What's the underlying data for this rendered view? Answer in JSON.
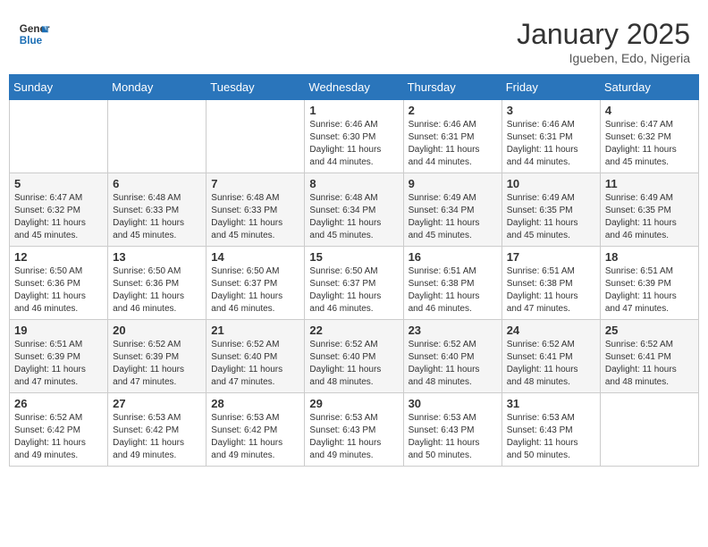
{
  "header": {
    "logo_general": "General",
    "logo_blue": "Blue",
    "month_title": "January 2025",
    "location": "Igueben, Edo, Nigeria"
  },
  "days_of_week": [
    "Sunday",
    "Monday",
    "Tuesday",
    "Wednesday",
    "Thursday",
    "Friday",
    "Saturday"
  ],
  "weeks": [
    [
      {
        "day": "",
        "info": ""
      },
      {
        "day": "",
        "info": ""
      },
      {
        "day": "",
        "info": ""
      },
      {
        "day": "1",
        "info": "Sunrise: 6:46 AM\nSunset: 6:30 PM\nDaylight: 11 hours and 44 minutes."
      },
      {
        "day": "2",
        "info": "Sunrise: 6:46 AM\nSunset: 6:31 PM\nDaylight: 11 hours and 44 minutes."
      },
      {
        "day": "3",
        "info": "Sunrise: 6:46 AM\nSunset: 6:31 PM\nDaylight: 11 hours and 44 minutes."
      },
      {
        "day": "4",
        "info": "Sunrise: 6:47 AM\nSunset: 6:32 PM\nDaylight: 11 hours and 45 minutes."
      }
    ],
    [
      {
        "day": "5",
        "info": "Sunrise: 6:47 AM\nSunset: 6:32 PM\nDaylight: 11 hours and 45 minutes."
      },
      {
        "day": "6",
        "info": "Sunrise: 6:48 AM\nSunset: 6:33 PM\nDaylight: 11 hours and 45 minutes."
      },
      {
        "day": "7",
        "info": "Sunrise: 6:48 AM\nSunset: 6:33 PM\nDaylight: 11 hours and 45 minutes."
      },
      {
        "day": "8",
        "info": "Sunrise: 6:48 AM\nSunset: 6:34 PM\nDaylight: 11 hours and 45 minutes."
      },
      {
        "day": "9",
        "info": "Sunrise: 6:49 AM\nSunset: 6:34 PM\nDaylight: 11 hours and 45 minutes."
      },
      {
        "day": "10",
        "info": "Sunrise: 6:49 AM\nSunset: 6:35 PM\nDaylight: 11 hours and 45 minutes."
      },
      {
        "day": "11",
        "info": "Sunrise: 6:49 AM\nSunset: 6:35 PM\nDaylight: 11 hours and 46 minutes."
      }
    ],
    [
      {
        "day": "12",
        "info": "Sunrise: 6:50 AM\nSunset: 6:36 PM\nDaylight: 11 hours and 46 minutes."
      },
      {
        "day": "13",
        "info": "Sunrise: 6:50 AM\nSunset: 6:36 PM\nDaylight: 11 hours and 46 minutes."
      },
      {
        "day": "14",
        "info": "Sunrise: 6:50 AM\nSunset: 6:37 PM\nDaylight: 11 hours and 46 minutes."
      },
      {
        "day": "15",
        "info": "Sunrise: 6:50 AM\nSunset: 6:37 PM\nDaylight: 11 hours and 46 minutes."
      },
      {
        "day": "16",
        "info": "Sunrise: 6:51 AM\nSunset: 6:38 PM\nDaylight: 11 hours and 46 minutes."
      },
      {
        "day": "17",
        "info": "Sunrise: 6:51 AM\nSunset: 6:38 PM\nDaylight: 11 hours and 47 minutes."
      },
      {
        "day": "18",
        "info": "Sunrise: 6:51 AM\nSunset: 6:39 PM\nDaylight: 11 hours and 47 minutes."
      }
    ],
    [
      {
        "day": "19",
        "info": "Sunrise: 6:51 AM\nSunset: 6:39 PM\nDaylight: 11 hours and 47 minutes."
      },
      {
        "day": "20",
        "info": "Sunrise: 6:52 AM\nSunset: 6:39 PM\nDaylight: 11 hours and 47 minutes."
      },
      {
        "day": "21",
        "info": "Sunrise: 6:52 AM\nSunset: 6:40 PM\nDaylight: 11 hours and 47 minutes."
      },
      {
        "day": "22",
        "info": "Sunrise: 6:52 AM\nSunset: 6:40 PM\nDaylight: 11 hours and 48 minutes."
      },
      {
        "day": "23",
        "info": "Sunrise: 6:52 AM\nSunset: 6:40 PM\nDaylight: 11 hours and 48 minutes."
      },
      {
        "day": "24",
        "info": "Sunrise: 6:52 AM\nSunset: 6:41 PM\nDaylight: 11 hours and 48 minutes."
      },
      {
        "day": "25",
        "info": "Sunrise: 6:52 AM\nSunset: 6:41 PM\nDaylight: 11 hours and 48 minutes."
      }
    ],
    [
      {
        "day": "26",
        "info": "Sunrise: 6:52 AM\nSunset: 6:42 PM\nDaylight: 11 hours and 49 minutes."
      },
      {
        "day": "27",
        "info": "Sunrise: 6:53 AM\nSunset: 6:42 PM\nDaylight: 11 hours and 49 minutes."
      },
      {
        "day": "28",
        "info": "Sunrise: 6:53 AM\nSunset: 6:42 PM\nDaylight: 11 hours and 49 minutes."
      },
      {
        "day": "29",
        "info": "Sunrise: 6:53 AM\nSunset: 6:43 PM\nDaylight: 11 hours and 49 minutes."
      },
      {
        "day": "30",
        "info": "Sunrise: 6:53 AM\nSunset: 6:43 PM\nDaylight: 11 hours and 50 minutes."
      },
      {
        "day": "31",
        "info": "Sunrise: 6:53 AM\nSunset: 6:43 PM\nDaylight: 11 hours and 50 minutes."
      },
      {
        "day": "",
        "info": ""
      }
    ]
  ]
}
